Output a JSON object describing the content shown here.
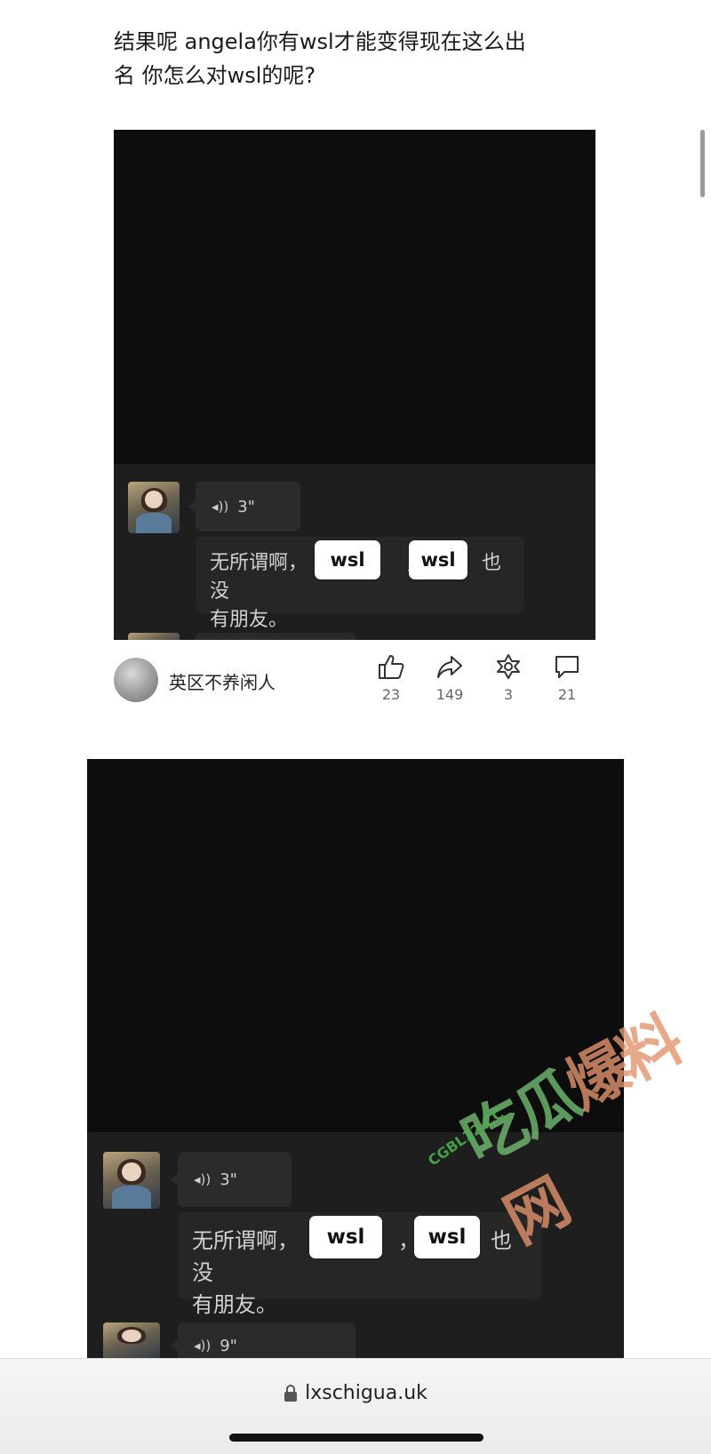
{
  "article": {
    "headline_line1": "结果呢 angela你有wsl才能变得现在这么出",
    "headline_line2": "名 你怎么对wsl的呢?"
  },
  "chat_card_1": {
    "voice_duration": "3\"",
    "transcript_part1": "无所谓啊，",
    "transcript_part2": "，",
    "transcript_part3": "也没",
    "transcript_line2": "有朋友。",
    "tag_1": "wsl",
    "tag_2": "wsl"
  },
  "post_footer": {
    "author_name": "英区不养闲人",
    "likes": "23",
    "shares": "149",
    "favorites": "3",
    "comments": "21"
  },
  "chat_card_2": {
    "voice_duration": "3\"",
    "transcript_part1": "无所谓啊，",
    "transcript_part2": "，",
    "transcript_part3": "也没",
    "transcript_line2": "有朋友。",
    "tag_1": "wsl",
    "tag_2": "wsl",
    "voice_duration_2": "9\""
  },
  "watermark": {
    "site": "CGBL12.CC",
    "text": "吃瓜爆料网"
  },
  "browser": {
    "url": "lxschigua.uk"
  },
  "icons": [
    "thumbs-up-icon",
    "share-icon",
    "favorite-star-icon",
    "comment-icon",
    "lock-icon",
    "voice-wave-icon"
  ]
}
